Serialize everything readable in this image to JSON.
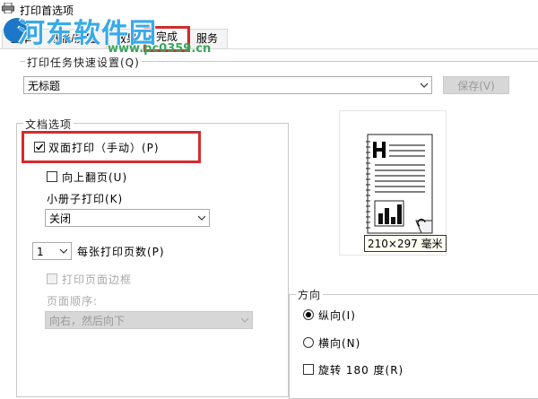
{
  "window": {
    "title": "打印首选项"
  },
  "watermark": {
    "text": "河东软件园",
    "url": "www.pc0359.cn"
  },
  "tabs": [
    {
      "label": "基本"
    },
    {
      "label": "纸张/质量"
    },
    {
      "label": "效果"
    },
    {
      "label": "完成"
    },
    {
      "label": "服务"
    }
  ],
  "quick_sets": {
    "label": "打印任务快速设置(Q)",
    "value": "无标题",
    "save_label": "保存(V)"
  },
  "doc_options": {
    "label": "文档选项",
    "duplex": {
      "label": "双面打印（手动）(P)",
      "checked": true
    },
    "flip_up": {
      "label": "向上翻页(U)",
      "checked": false
    },
    "booklet_label": "小册子打印(K)",
    "booklet_value": "关闭",
    "pages_per_sheet_value": "1",
    "pages_per_sheet_label": "每张打印页数(P)",
    "print_borders": {
      "label": "打印页面边框",
      "checked": false
    },
    "page_order_label": "页面顺序:",
    "page_order_value": "向右，然后向下"
  },
  "preview": {
    "paper_size": "210×297 毫米"
  },
  "orientation": {
    "label": "方向",
    "portrait": "纵向(I)",
    "landscape": "横向(N)",
    "rotate": "旋转 180 度(R)",
    "selected": "portrait"
  },
  "colors": {
    "highlight": "#d42c2c",
    "watermark": "#39a9e8",
    "watermark_url": "#3aa65a"
  }
}
